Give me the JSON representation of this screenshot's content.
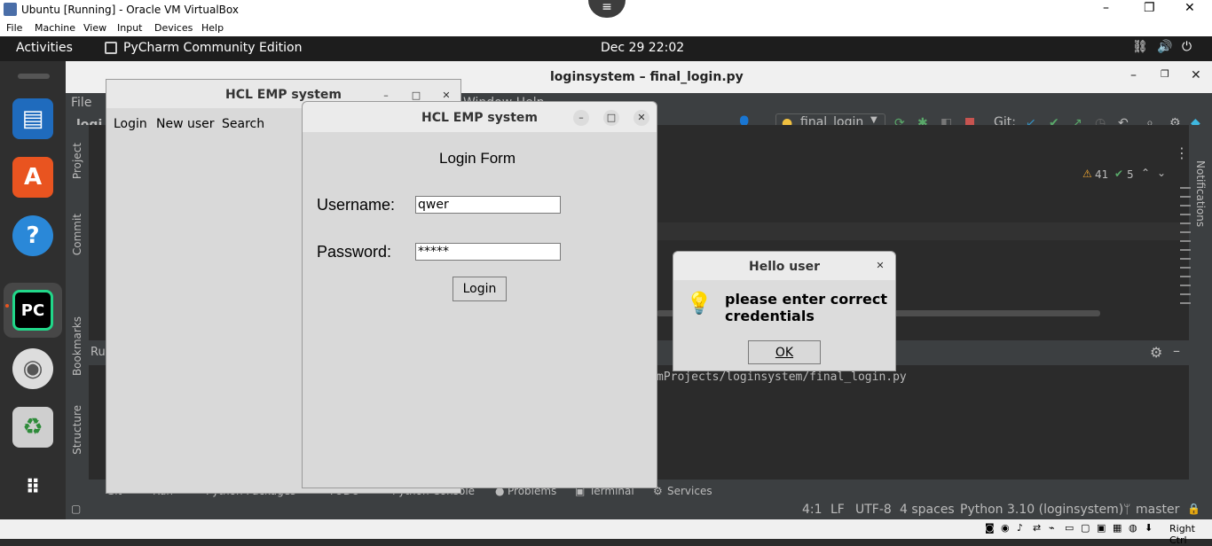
{
  "vb": {
    "title": "Ubuntu [Running] - Oracle VM VirtualBox",
    "menu": [
      "File",
      "Machine",
      "View",
      "Input",
      "Devices",
      "Help"
    ],
    "host_key": "Right Ctrl"
  },
  "topbar": {
    "activities": "Activities",
    "app_name": "PyCharm Community Edition",
    "datetime": "Dec 29  22:02"
  },
  "pycharm": {
    "title": "loginsystem – final_login.py",
    "menu_file": "File",
    "project_short": "logi",
    "menu_partial": "Window  Help",
    "run_config": "final_login",
    "git_label": "Git:",
    "warnings": "41",
    "checks": "5",
    "run_label": "Ru",
    "run_path": "mProjects/loginsystem/final_login.py",
    "sidebar": [
      "Project",
      "Commit",
      "Bookmarks",
      "Structure"
    ],
    "notifications": "Notifications",
    "bottom_tabs": [
      "Git",
      "Run",
      "Python Packages",
      "TODO",
      "Python Console",
      "Problems",
      "Terminal",
      "Services"
    ],
    "status": {
      "position": "4:1",
      "line_sep": "LF",
      "encoding": "UTF-8",
      "indent": "4 spaces",
      "interpreter": "Python 3.10 (loginsystem)",
      "branch": "master"
    }
  },
  "main_window": {
    "title": "HCL EMP system",
    "menu": [
      "Login",
      "New user",
      "Search"
    ]
  },
  "login_window": {
    "title": "HCL EMP system",
    "heading": "Login Form",
    "username_label": "Username:",
    "username_value": "qwer",
    "password_label": "Password:",
    "password_value": "*****",
    "login_button": "Login"
  },
  "dialog": {
    "title": "Hello user",
    "message": "please enter correct credentials",
    "ok_button": "OK"
  }
}
